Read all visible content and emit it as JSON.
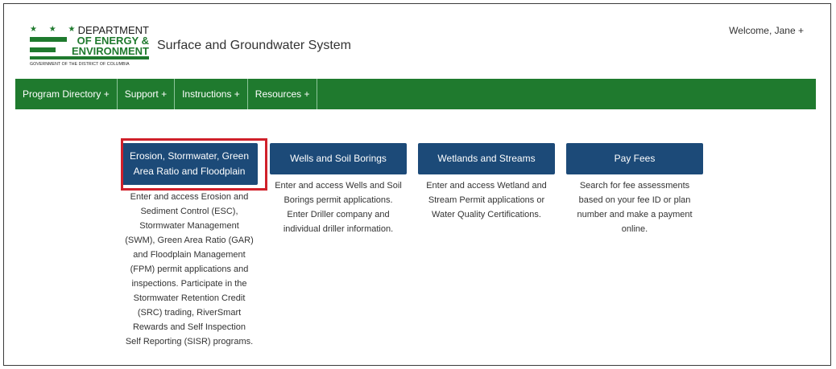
{
  "header": {
    "logo": {
      "stars": "★ ★ ★",
      "line1": "DEPARTMENT",
      "line2": "OF ENERGY &",
      "line3": "ENVIRONMENT",
      "subtitle": "GOVERNMENT OF THE DISTRICT OF COLUMBIA"
    },
    "title": "Surface and Groundwater System",
    "welcome": "Welcome, Jane +"
  },
  "nav": {
    "items": [
      {
        "label": "Program Directory +"
      },
      {
        "label": "Support +"
      },
      {
        "label": "Instructions +"
      },
      {
        "label": "Resources +"
      }
    ]
  },
  "cards": [
    {
      "button": "Erosion, Stormwater, Green Area Ratio and Floodplain",
      "description": "Enter and access Erosion and Sediment Control (ESC), Stormwater Management (SWM), Green Area Ratio (GAR) and Floodplain Management (FPM) permit applications and inspections. Participate in the Stormwater Retention Credit (SRC) trading, RiverSmart Rewards and Self Inspection Self Reporting (SISR) programs."
    },
    {
      "button": "Wells and Soil Borings",
      "description": "Enter and access Wells and Soil Borings permit applications. Enter Driller company and individual driller information."
    },
    {
      "button": "Wetlands and Streams",
      "description": "Enter and access Wetland and Stream Permit applications or Water Quality Certifications."
    },
    {
      "button": "Pay Fees",
      "description": "Search for fee assessments based on your fee ID or plan number and make a payment online."
    }
  ],
  "colors": {
    "nav_green": "#1f7a2e",
    "button_blue": "#1c4a78",
    "highlight_red": "#d0202a"
  }
}
